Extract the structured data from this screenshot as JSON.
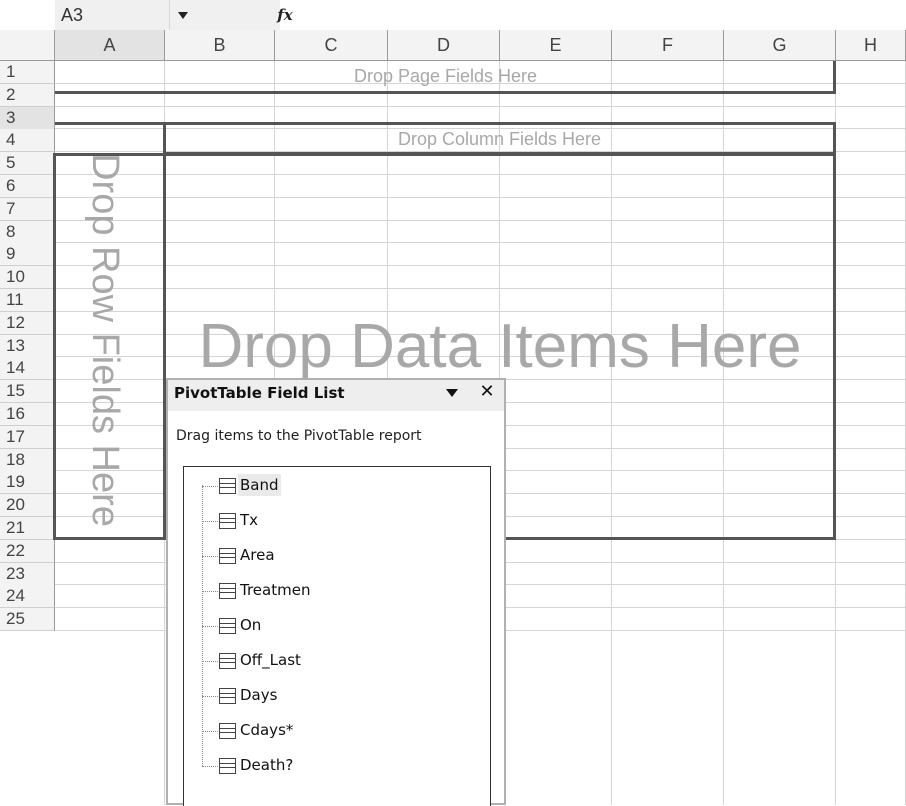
{
  "formula_bar": {
    "name_box": "A3",
    "fx_label": "fx"
  },
  "columns": [
    "A",
    "B",
    "C",
    "D",
    "E",
    "F",
    "G",
    "H"
  ],
  "rows": [
    "1",
    "2",
    "3",
    "4",
    "5",
    "6",
    "7",
    "8",
    "9",
    "10",
    "11",
    "12",
    "13",
    "14",
    "15",
    "16",
    "17",
    "18",
    "19",
    "20",
    "21",
    "22",
    "23",
    "24",
    "25"
  ],
  "pivot": {
    "page_zone": "Drop Page Fields Here",
    "column_zone": "Drop Column Fields Here",
    "row_zone": "Drop Row Fields Here",
    "data_zone": "Drop Data Items Here"
  },
  "field_list": {
    "title": "PivotTable Field List",
    "instruction": "Drag items to the PivotTable report",
    "fields": [
      "Band",
      "Tx",
      "Area",
      "Treatmen",
      "On",
      "Off_Last",
      "Days",
      "Cdays*",
      "Death?"
    ]
  }
}
